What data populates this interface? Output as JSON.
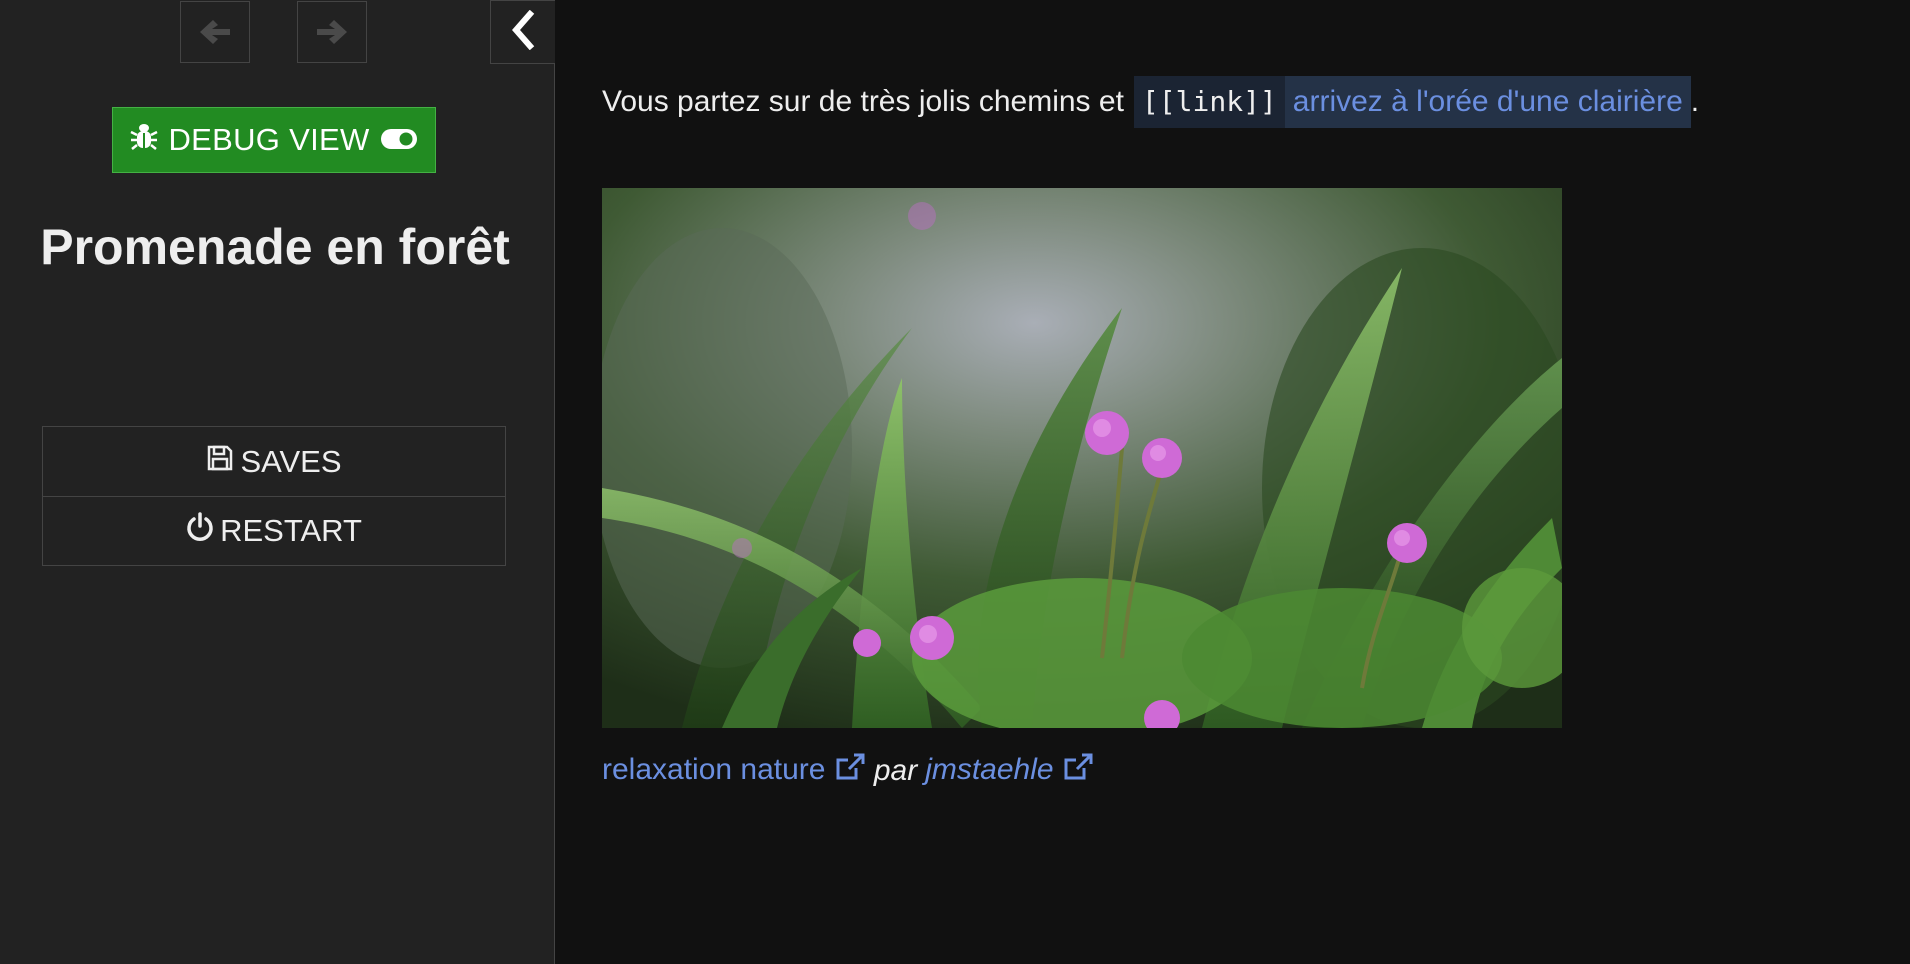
{
  "sidebar": {
    "history_backward_icon": "arrow-left-icon",
    "history_forward_icon": "arrow-right-icon",
    "collapse_icon": "chevron-left-icon",
    "debug": {
      "label": "DEBUG VIEW",
      "icon": "bug-icon",
      "toggle_icon": "toggle-on-icon",
      "color": "#228b22"
    },
    "title": "Promenade en forêt",
    "menu": [
      {
        "label": "SAVES",
        "icon": "floppy-disk-icon"
      },
      {
        "label": "RESTART",
        "icon": "power-icon"
      }
    ]
  },
  "passage": {
    "text_before": "Vous partez sur de très jolis chemins et",
    "link_code": "[[link]]",
    "link_text": "arrivez à l'orée d'une clairière",
    "text_after": ".",
    "link_color": "#6b8fe0",
    "credit": {
      "photo_title": "relaxation nature",
      "by": "par",
      "author": "jmstaehle",
      "external_icon": "external-link-icon"
    }
  }
}
